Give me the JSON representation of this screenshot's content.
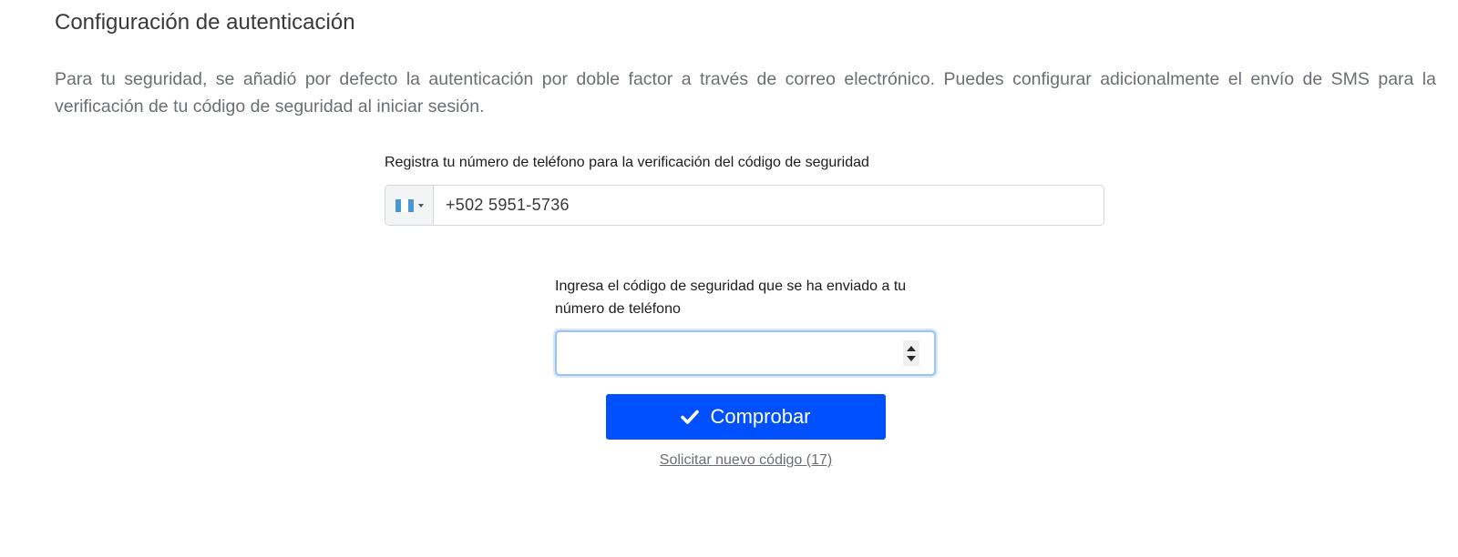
{
  "section": {
    "title": "Configuración de autenticación",
    "description": "Para tu seguridad, se añadió por defecto la autenticación por doble factor a través de correo electrónico. Puedes configurar adicionalmente el envío de SMS para la verificación de tu código de seguridad al iniciar sesión."
  },
  "phone": {
    "label": "Registra tu número de teléfono para la verificación del código de seguridad",
    "country_flag_icon": "flag-guatemala-icon",
    "value": "+502 5951-5736"
  },
  "code": {
    "label": "Ingresa el código de seguridad que se ha enviado a tu número de teléfono",
    "value": "",
    "placeholder": ""
  },
  "actions": {
    "check_label": "Comprobar",
    "check_icon": "checkmark-icon",
    "resend_label": "Solicitar nuevo código (17)"
  },
  "colors": {
    "primary_button": "#0050ff",
    "input_focus_border": "#9cc3f5",
    "muted_text": "#6b6f75"
  }
}
